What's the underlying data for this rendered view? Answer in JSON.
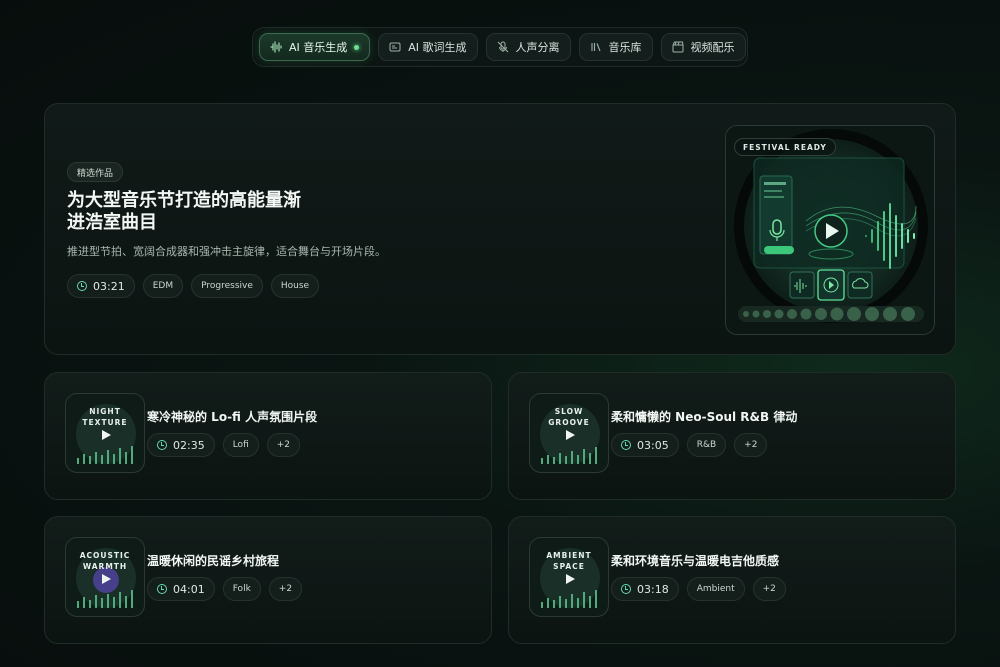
{
  "nav": {
    "tabs": [
      {
        "label": "AI 音乐生成",
        "icon": "waveform-icon",
        "active": true
      },
      {
        "label": "AI 歌词生成",
        "icon": "lyrics-icon",
        "active": false
      },
      {
        "label": "人声分离",
        "icon": "mic-off-icon",
        "active": false
      },
      {
        "label": "音乐库",
        "icon": "library-icon",
        "active": false
      },
      {
        "label": "视频配乐",
        "icon": "clapperboard-icon",
        "active": false
      }
    ]
  },
  "hero": {
    "badge": "精选作品",
    "title": "为大型音乐节打造的高能量渐进浩室曲目",
    "description": "推进型节拍、宽阔合成器和强冲击主旋律，适合舞台与开场片段。",
    "duration": "03:21",
    "tags": [
      "EDM",
      "Progressive",
      "House"
    ],
    "art_label": "FESTIVAL READY"
  },
  "cards": [
    {
      "thumb_label_1": "NIGHT",
      "thumb_label_2": "TEXTURE",
      "title": "寒冷神秘的 Lo-fi 人声氛围片段",
      "duration": "02:35",
      "tag": "Lofi",
      "more": "+2"
    },
    {
      "thumb_label_1": "SLOW",
      "thumb_label_2": "GROOVE",
      "title": "柔和慵懒的 Neo-Soul R&B 律动",
      "duration": "03:05",
      "tag": "R&B",
      "more": "+2"
    },
    {
      "thumb_label_1": "ACOUSTIC",
      "thumb_label_2": "WARMTH",
      "title": "温暖休闲的民谣乡村旅程",
      "duration": "04:01",
      "tag": "Folk",
      "more": "+2"
    },
    {
      "thumb_label_1": "AMBIENT",
      "thumb_label_2": "SPACE",
      "title": "柔和环境音乐与温暖电吉他质感",
      "duration": "03:18",
      "tag": "Ambient",
      "more": "+2"
    }
  ],
  "colors": {
    "accent": "#6fe08f",
    "teal": "#67d6b0",
    "bg": "#070d0c"
  }
}
